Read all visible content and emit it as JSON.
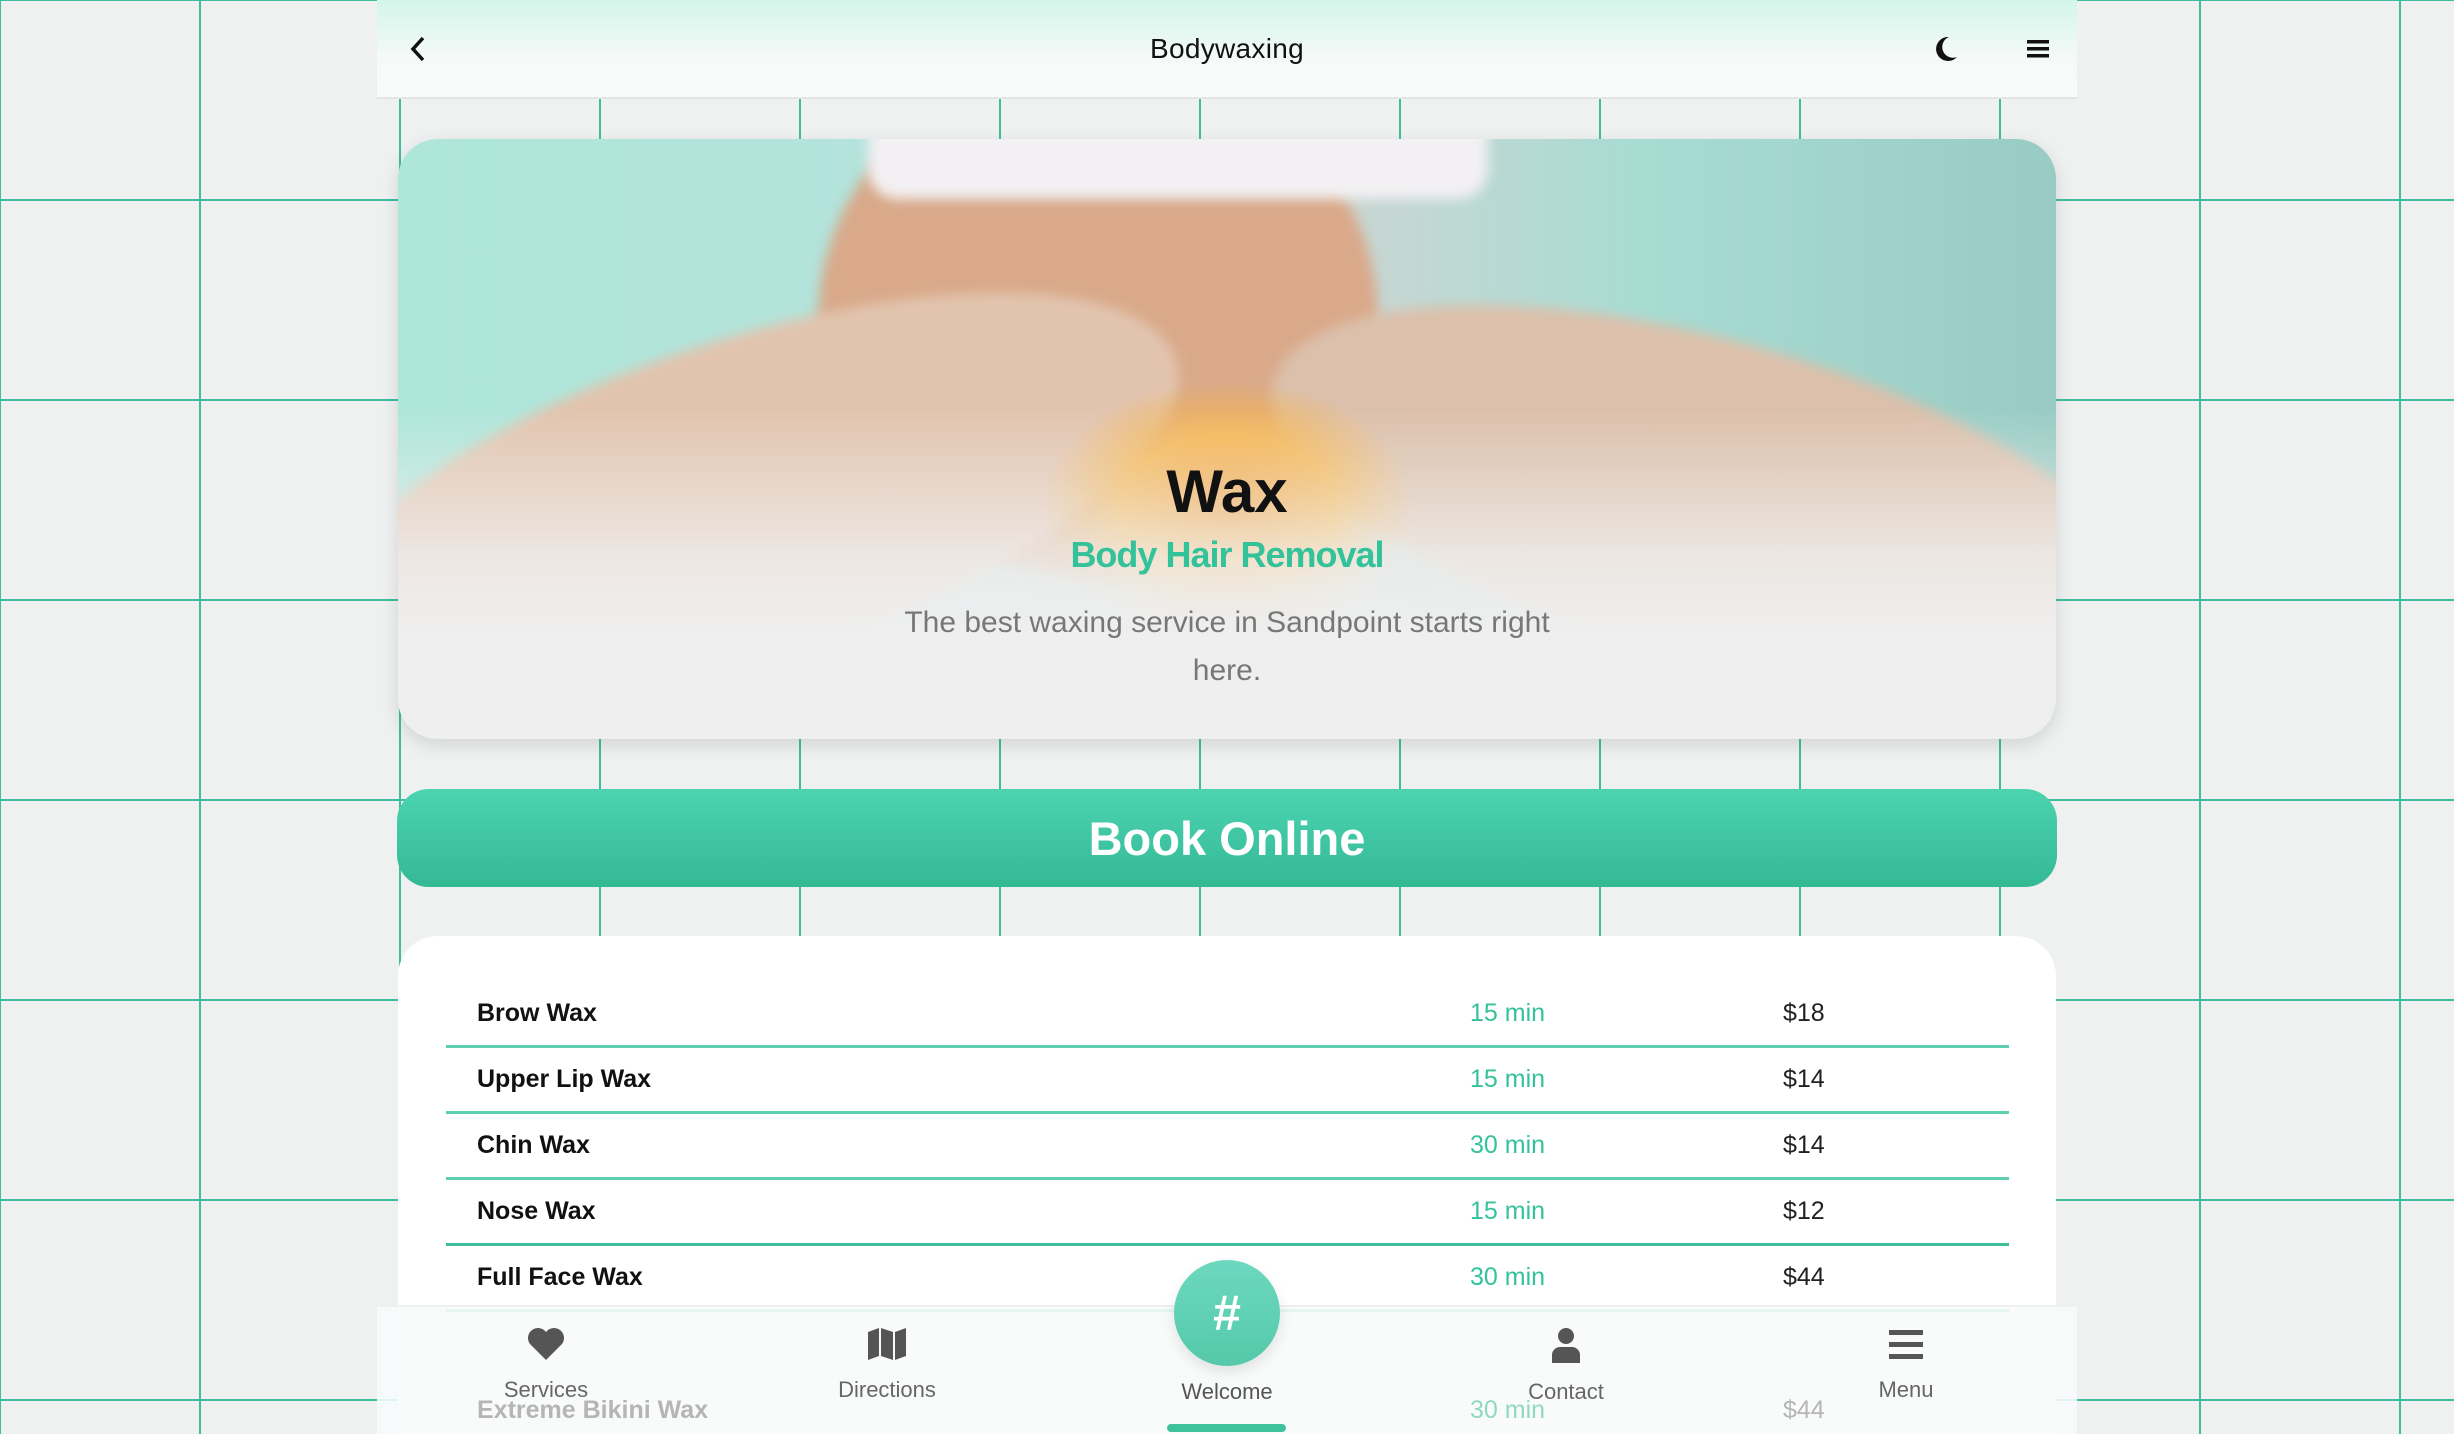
{
  "header": {
    "title": "Bodywaxing"
  },
  "hero": {
    "title": "Wax",
    "subtitle": "Body Hair Removal",
    "description": "The best waxing service in Sandpoint starts right here."
  },
  "book_label": "Book Online",
  "services": [
    {
      "name": "Brow Wax",
      "time": "15 min",
      "price": "$18"
    },
    {
      "name": "Upper Lip Wax",
      "time": "15 min",
      "price": "$14"
    },
    {
      "name": "Chin Wax",
      "time": "30 min",
      "price": "$14"
    },
    {
      "name": "Nose Wax",
      "time": "15 min",
      "price": "$12"
    },
    {
      "name": "Full Face Wax",
      "time": "30 min",
      "price": "$44"
    },
    {
      "name": "Extreme Bikini Wax",
      "time": "30 min",
      "price": "$44"
    }
  ],
  "nav": {
    "services": "Services",
    "directions": "Directions",
    "welcome": "Welcome",
    "welcome_icon": "#",
    "contact": "Contact",
    "menu": "Menu"
  },
  "colors": {
    "accent": "#34c29b",
    "grid": "#3dbf9f"
  }
}
